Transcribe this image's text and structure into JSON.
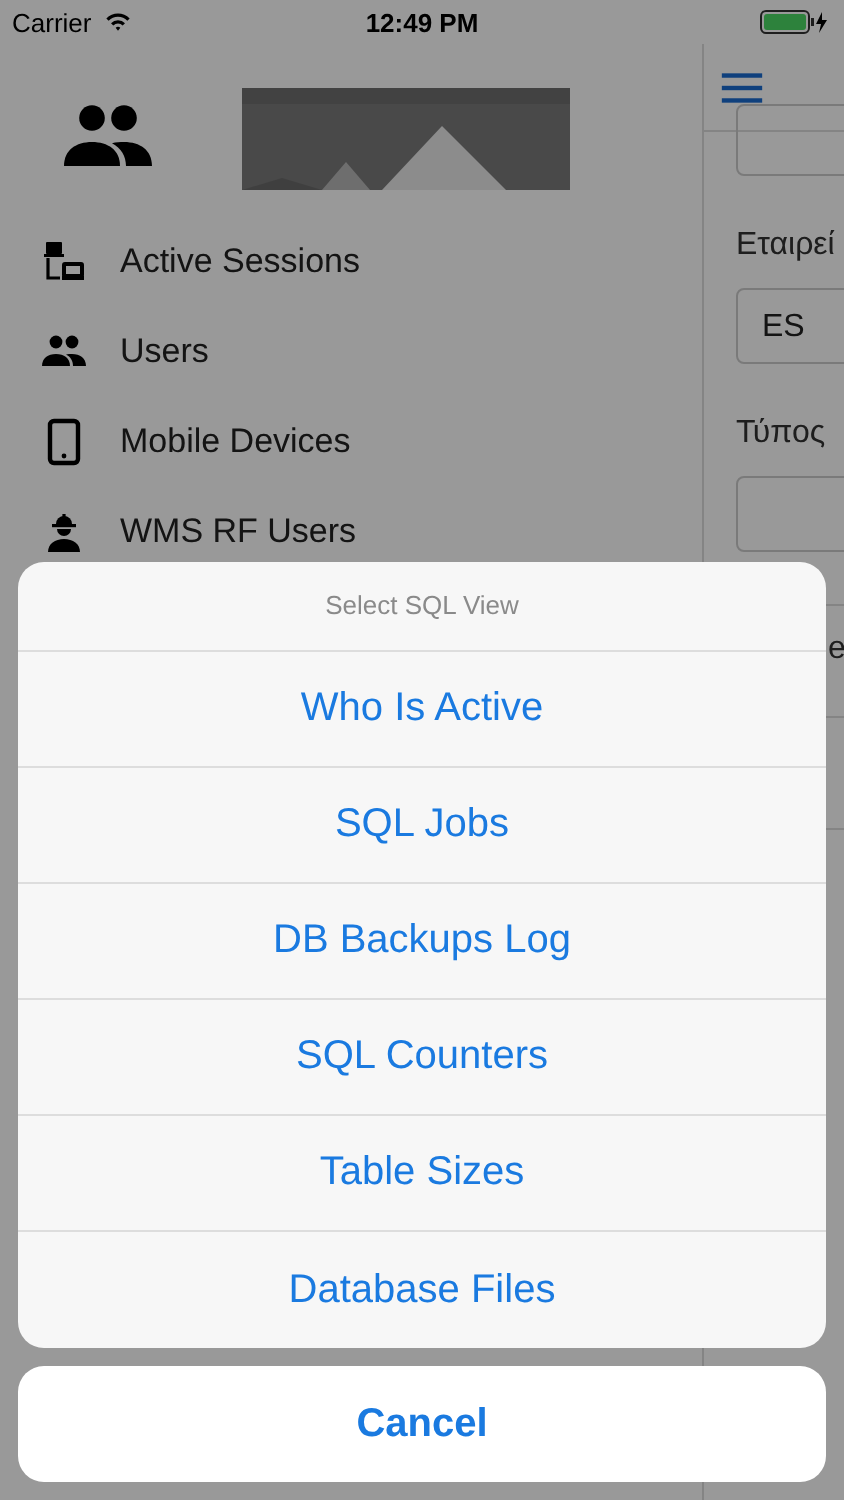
{
  "status_bar": {
    "carrier": "Carrier",
    "time": "12:49 PM"
  },
  "sidebar": {
    "items": [
      {
        "label": "Active Sessions"
      },
      {
        "label": "Users"
      },
      {
        "label": "Mobile Devices"
      },
      {
        "label": "WMS RF Users"
      }
    ]
  },
  "form": {
    "fields": [
      {
        "kind": "field"
      },
      {
        "kind": "label",
        "text": "Εταιρεί"
      },
      {
        "kind": "field",
        "value": "ES"
      },
      {
        "kind": "label",
        "text": "Τύπος"
      },
      {
        "kind": "field"
      },
      {
        "kind": "row",
        "text": "e"
      }
    ]
  },
  "action_sheet": {
    "title": "Select SQL View",
    "options": [
      "Who Is Active",
      "SQL Jobs",
      "DB Backups Log",
      "SQL Counters",
      "Table Sizes",
      "Database Files"
    ],
    "cancel": "Cancel"
  }
}
